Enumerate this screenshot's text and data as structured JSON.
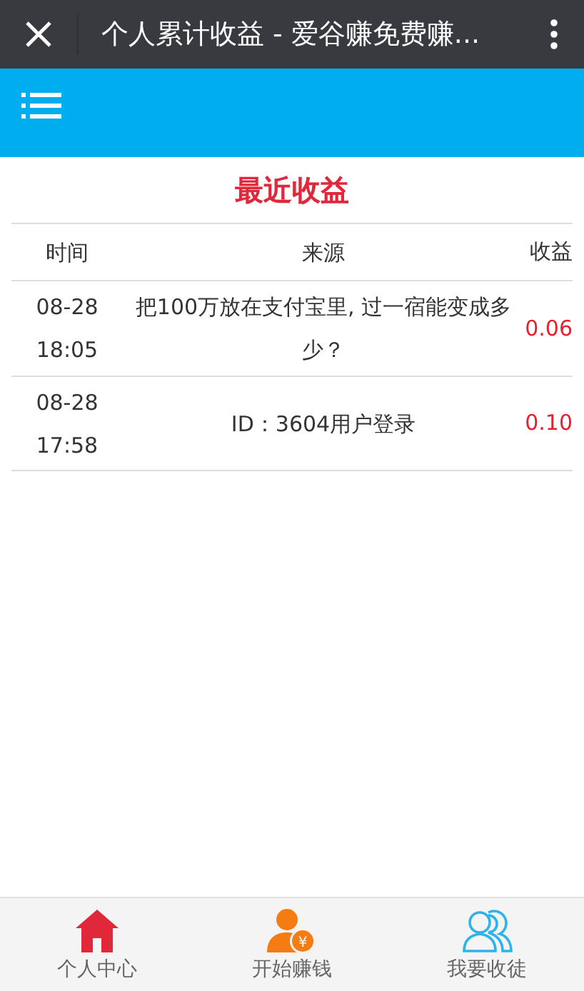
{
  "window": {
    "title": "个人累计收益 - 爱谷赚免费赚..."
  },
  "section_title": "最近收益",
  "table": {
    "columns": [
      "时间",
      "来源",
      "收益"
    ],
    "rows": [
      {
        "date": "08-28",
        "time": "18:05",
        "source": "把100万放在支付宝里, 过一宿能变成多少？",
        "amount": "0.06"
      },
      {
        "date": "08-28",
        "time": "17:58",
        "source": "ID：3604用户登录",
        "amount": "0.10"
      }
    ]
  },
  "tab_bar": [
    {
      "kind": "home",
      "label": "个人中心",
      "color": "#e0283a"
    },
    {
      "kind": "earn",
      "label": "开始赚钱",
      "color": "#f57c12",
      "symbol": "¥"
    },
    {
      "kind": "people",
      "label": "我要收徒",
      "color": "#2eb3e8"
    }
  ]
}
